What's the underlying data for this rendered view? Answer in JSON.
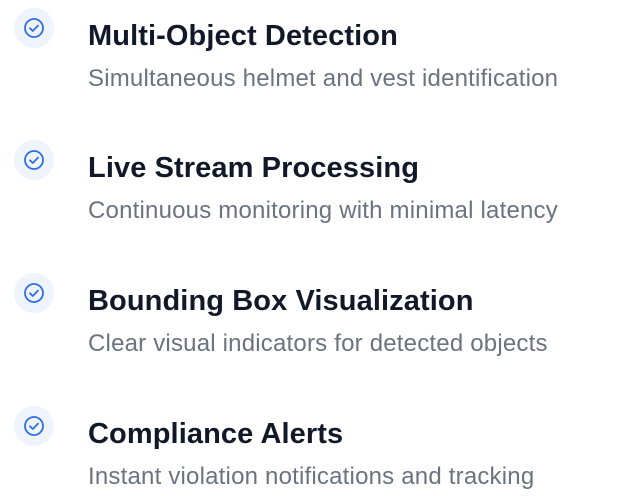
{
  "features": [
    {
      "icon": "check-circle-icon",
      "title": "Multi-Object Detection",
      "description": "Simultaneous helmet and vest identification"
    },
    {
      "icon": "check-circle-icon",
      "title": "Live Stream Processing",
      "description": "Continuous monitoring with minimal latency"
    },
    {
      "icon": "check-circle-icon",
      "title": "Bounding Box Visualization",
      "description": "Clear visual indicators for detected objects"
    },
    {
      "icon": "check-circle-icon",
      "title": "Compliance Alerts",
      "description": "Instant violation notifications and tracking"
    }
  ],
  "colors": {
    "accent": "#2f6fe4",
    "icon_background": "#eef3fc",
    "title": "#111827",
    "description": "#6b7280"
  }
}
